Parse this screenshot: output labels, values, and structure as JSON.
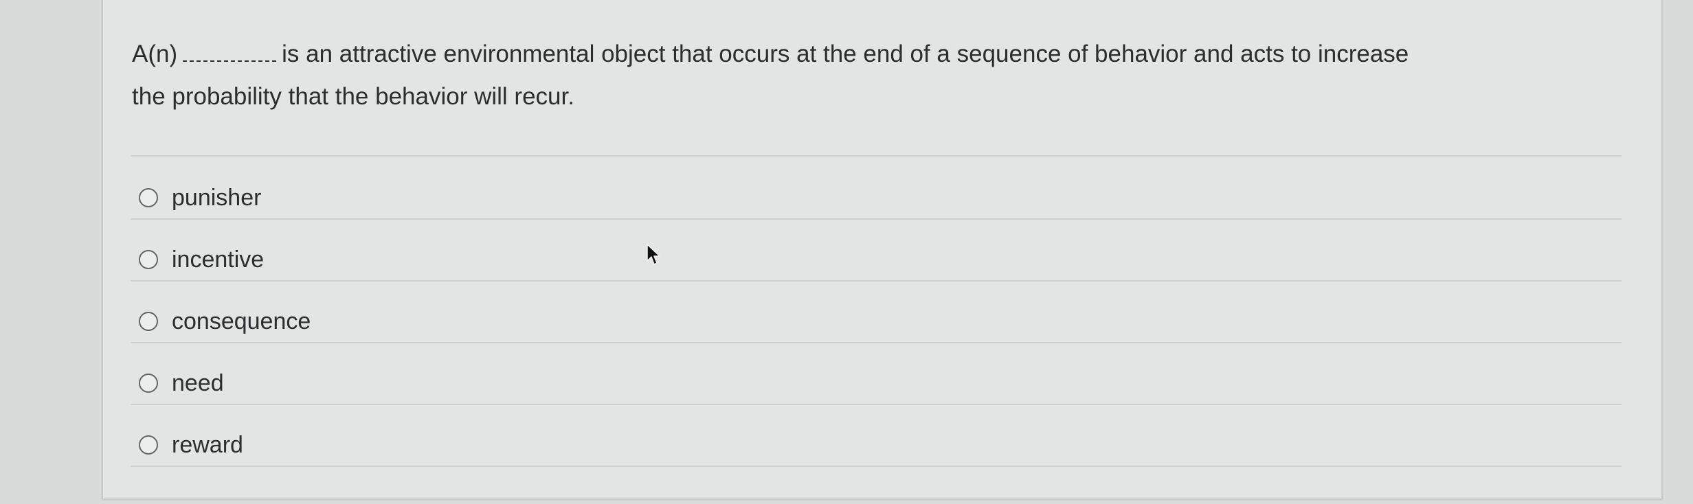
{
  "question": {
    "prefix": "A(n)",
    "line1_rest": "is an attractive environmental object that occurs at the end of a sequence of behavior and acts to increase",
    "line2": "the probability that the behavior will recur."
  },
  "options": [
    {
      "label": "punisher",
      "selected": false
    },
    {
      "label": "incentive",
      "selected": false
    },
    {
      "label": "consequence",
      "selected": false
    },
    {
      "label": "need",
      "selected": false
    },
    {
      "label": "reward",
      "selected": false
    }
  ],
  "icons": {
    "cursor": "mouse-pointer-icon",
    "radio": "radio-button-icon"
  },
  "colors": {
    "text": "#2b2d2e",
    "card_background": "#e3e5e4",
    "page_background": "#d9dbda"
  }
}
